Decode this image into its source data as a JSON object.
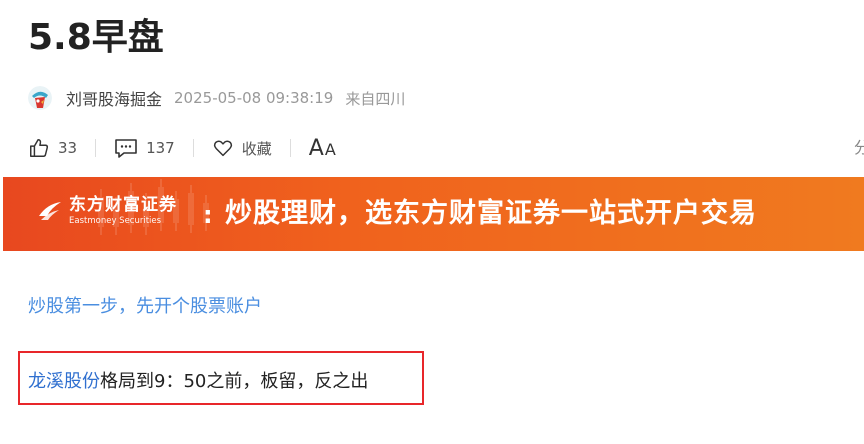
{
  "article": {
    "title": "5.8早盘",
    "author": "刘哥股海掘金",
    "time": "2025-05-08 09:38:19",
    "location": "来自四川"
  },
  "actions": {
    "like_count": "33",
    "comment_count": "137",
    "favorite_label": "收藏",
    "font_big": "A",
    "font_small": "A",
    "share_stub": "分"
  },
  "banner": {
    "brand_cn": "东方财富证券",
    "brand_en": "Eastmoney Securities",
    "separator": ":",
    "slogan": "炒股理财，选东方财富证券一站式开户交易"
  },
  "promo_link": "炒股第一步，先开个股票账户",
  "content": {
    "stock_name": "龙溪股份",
    "text": "格局到9：50之前，板留，反之出"
  },
  "colors": {
    "banner": "#ef5a1e",
    "link": "#4a8ee0",
    "highlight_border": "#e8262a"
  },
  "icons": [
    "like-icon",
    "comment-icon",
    "heart-icon"
  ]
}
